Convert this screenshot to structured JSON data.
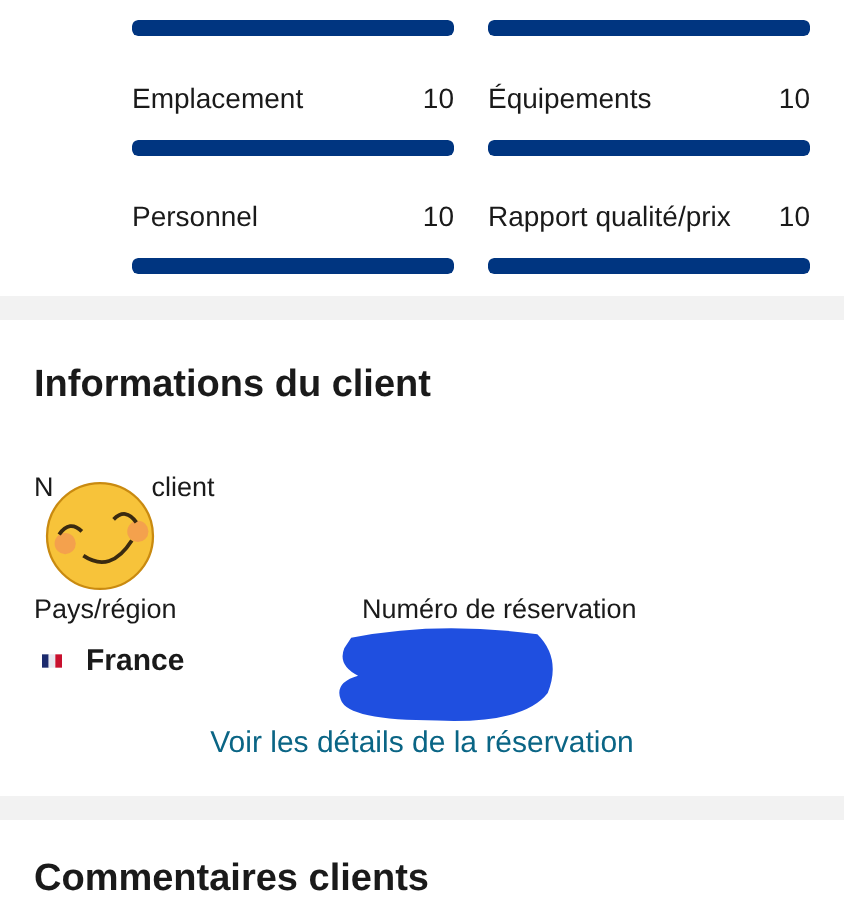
{
  "ratings": [
    {
      "level": 1
    },
    {
      "level": 1
    },
    {
      "label": "Emplacement",
      "score": "10",
      "level": 1
    },
    {
      "label": "Équipements",
      "score": "10",
      "level": 1
    },
    {
      "label": "Personnel",
      "score": "10",
      "level": 1
    },
    {
      "label": "Rapport qualité/prix",
      "score": "10",
      "level": 1
    }
  ],
  "client_info": {
    "title": "Informations du client",
    "name_label_parts": [
      "N",
      "client"
    ],
    "country_label": "Pays/région",
    "country": "France",
    "reservation_label": "Numéro de réservation",
    "details_link": "Voir les détails de la réservation"
  },
  "next_section": {
    "title": "Commentaires clients"
  }
}
